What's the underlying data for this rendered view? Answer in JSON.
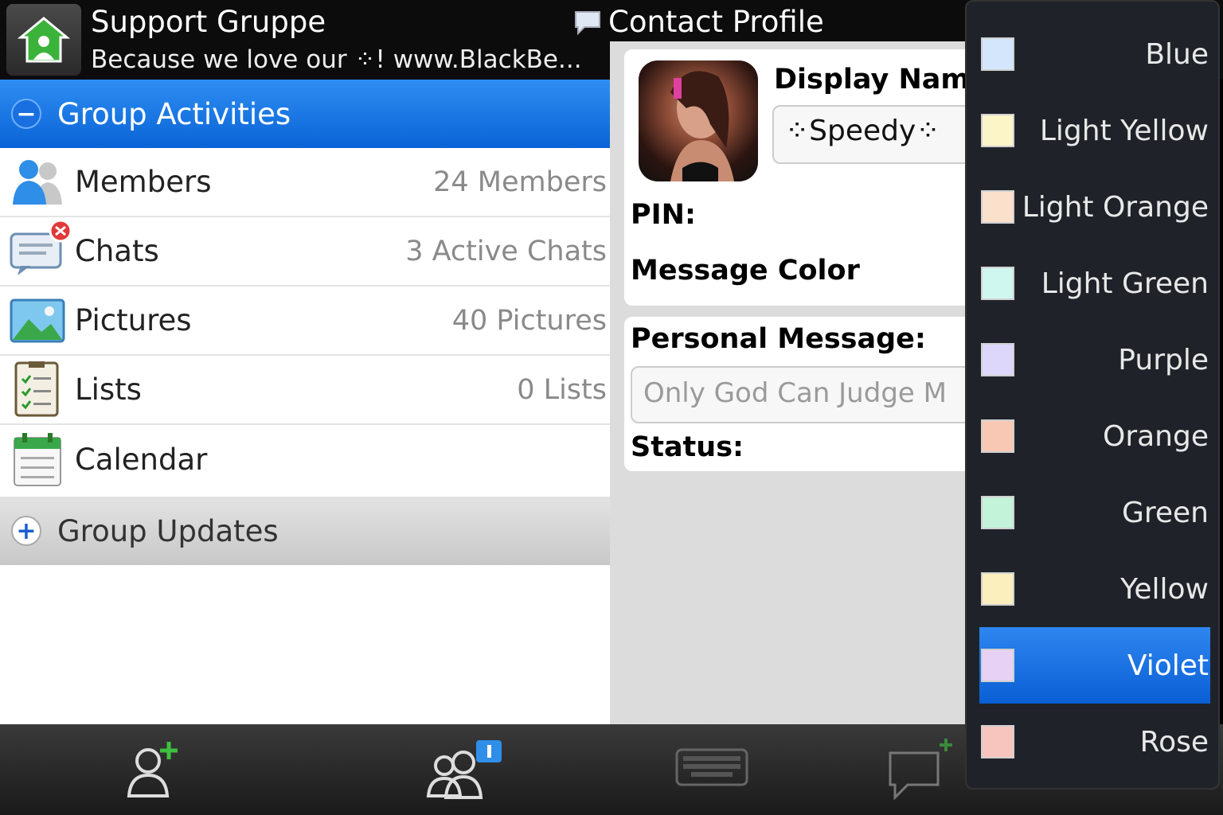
{
  "header": {
    "group_name": "Support Gruppe",
    "group_description": "Because we love our ⁘! www.BlackBe...",
    "profile_title": "Contact Profile"
  },
  "group_activities": {
    "title": "Group Activities",
    "toggle": "−",
    "items": [
      {
        "label": "Members",
        "count": "24 Members",
        "icon": "members-icon"
      },
      {
        "label": "Chats",
        "count": "3 Active Chats",
        "icon": "chats-icon"
      },
      {
        "label": "Pictures",
        "count": "40 Pictures",
        "icon": "pictures-icon"
      },
      {
        "label": "Lists",
        "count": "0 Lists",
        "icon": "lists-icon"
      },
      {
        "label": "Calendar",
        "count": "",
        "icon": "calendar-icon"
      }
    ]
  },
  "group_updates": {
    "title": "Group Updates",
    "toggle": "+"
  },
  "profile": {
    "display_name_label": "Display Nam",
    "display_name_value": "⁘Speedy⁘",
    "pin_label": "PIN:",
    "message_color_label": "Message Color",
    "personal_message_label": "Personal Message:",
    "personal_message_value": "Only God Can Judge M",
    "status_label": "Status:"
  },
  "color_menu": {
    "selected": "Violet",
    "items": [
      {
        "label": "Blue",
        "color": "#d4e6fb"
      },
      {
        "label": "Light Yellow",
        "color": "#fbf5c8"
      },
      {
        "label": "Light Orange",
        "color": "#fbe0cc"
      },
      {
        "label": "Light Green",
        "color": "#cff7ef"
      },
      {
        "label": "Purple",
        "color": "#dcd7fb"
      },
      {
        "label": "Orange",
        "color": "#f9c8b4"
      },
      {
        "label": "Green",
        "color": "#c3f3d9"
      },
      {
        "label": "Yellow",
        "color": "#fbf0bd"
      },
      {
        "label": "Violet",
        "color": "#e7d2f5"
      },
      {
        "label": "Rose",
        "color": "#f7c5bd"
      }
    ]
  },
  "bottom_bar": {
    "buttons": [
      "invite-member-icon",
      "group-members-info-icon",
      "keyboard-icon",
      "new-chat-icon"
    ]
  },
  "colors": {
    "accent_blue": "#0a63d6",
    "menu_background": "#1f2329"
  }
}
